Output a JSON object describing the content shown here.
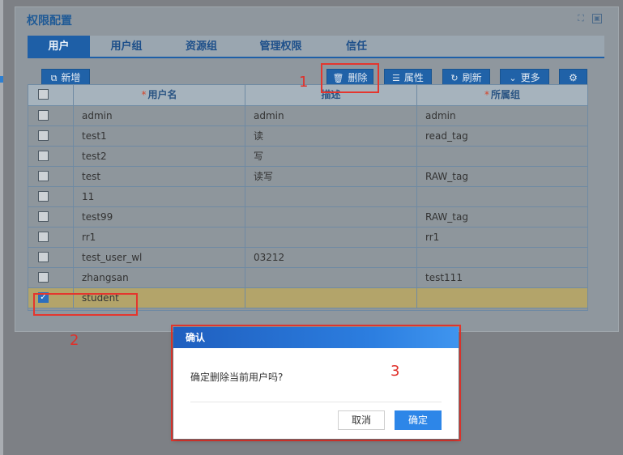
{
  "panel": {
    "title": "权限配置"
  },
  "tabs": [
    "用户",
    "用户组",
    "资源组",
    "管理权限",
    "信任"
  ],
  "toolbar": {
    "add": "新增",
    "delete": "删除",
    "properties": "属性",
    "refresh": "刷新",
    "more": "更多"
  },
  "table": {
    "columns": [
      {
        "label": "用户名",
        "required": "*"
      },
      {
        "label": "描述",
        "required": ""
      },
      {
        "label": "所属组",
        "required": "*"
      }
    ],
    "rows": [
      {
        "username": "admin",
        "desc": "admin",
        "group": "admin",
        "checked": false
      },
      {
        "username": "test1",
        "desc": "读",
        "group": "read_tag",
        "checked": false
      },
      {
        "username": "test2",
        "desc": "写",
        "group": "",
        "checked": false
      },
      {
        "username": "test",
        "desc": "读写",
        "group": "RAW_tag",
        "checked": false
      },
      {
        "username": "11",
        "desc": "",
        "group": "",
        "checked": false
      },
      {
        "username": "test99",
        "desc": "",
        "group": "RAW_tag",
        "checked": false
      },
      {
        "username": "rr1",
        "desc": "",
        "group": "rr1",
        "checked": false
      },
      {
        "username": "test_user_wl",
        "desc": "03212",
        "group": "",
        "checked": false
      },
      {
        "username": "zhangsan",
        "desc": "",
        "group": "test111",
        "checked": false
      },
      {
        "username": "student",
        "desc": "",
        "group": "",
        "checked": true
      }
    ]
  },
  "annotations": {
    "step1": "1",
    "step2": "2",
    "step3": "3"
  },
  "dialog": {
    "title": "确认",
    "message": "确定删除当前用户吗?",
    "cancel": "取消",
    "ok": "确定"
  }
}
